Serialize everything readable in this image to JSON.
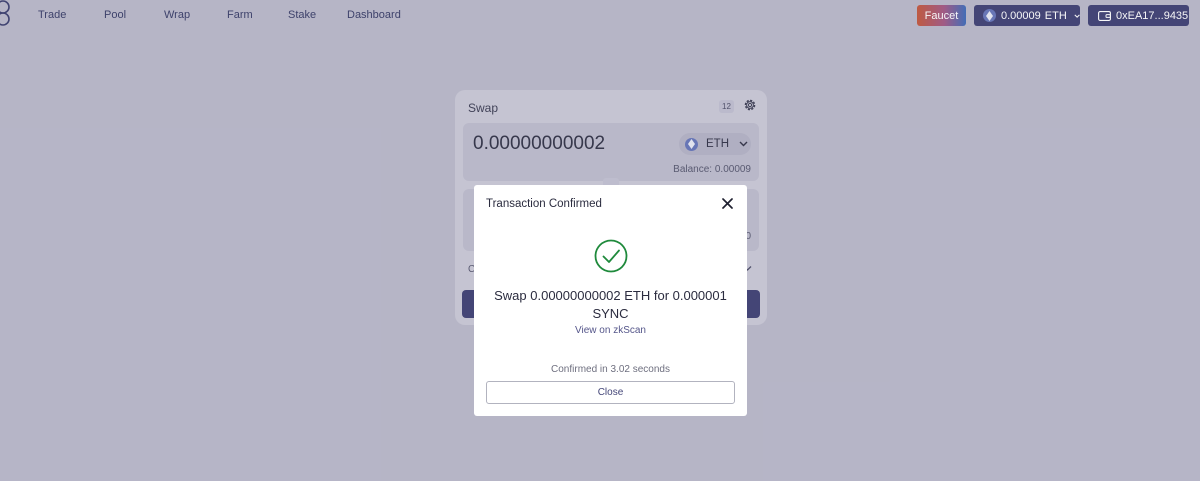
{
  "nav": {
    "items": [
      "Trade",
      "Pool",
      "Wrap",
      "Farm",
      "Stake",
      "Dashboard"
    ]
  },
  "header": {
    "faucet_label": "Faucet",
    "balance_amount": "0.00009",
    "balance_token": "ETH",
    "wallet_address": "0xEA17...9435"
  },
  "swap": {
    "title": "Swap",
    "slippage_badge": "12",
    "input_amount": "0.00000000002",
    "input_token": "ETH",
    "input_balance": "Balance: 0.00009",
    "output_balance_fragment": "0",
    "details_fragment": "C"
  },
  "modal": {
    "title": "Transaction Confirmed",
    "message": "Swap 0.00000000002 ETH for 0.000001 SYNC",
    "link_label": "View on zkScan",
    "confirmed_text": "Confirmed in 3.02 seconds",
    "close_label": "Close"
  },
  "colors": {
    "accent": "#3d3e72",
    "success": "#1f8a3c"
  },
  "icons": {
    "logo": "logo-icon",
    "eth": "eth-icon",
    "wallet": "wallet-icon",
    "settings": "gear-icon",
    "close": "close-icon",
    "success": "check-circle-icon"
  }
}
